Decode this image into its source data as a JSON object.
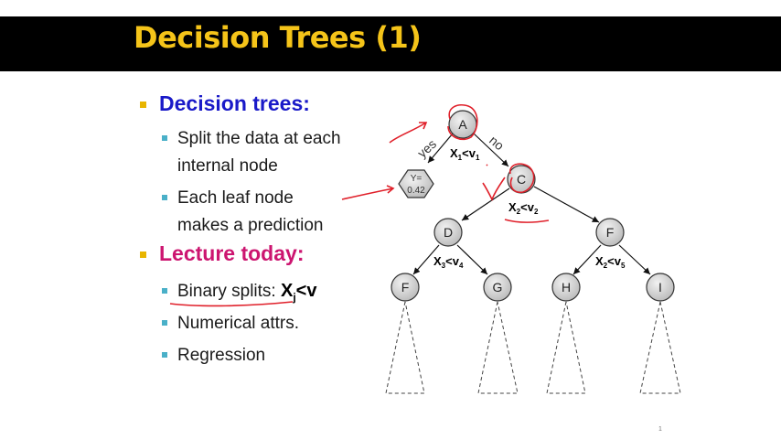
{
  "slide": {
    "title": "Decision Trees (1)",
    "page_number": "1"
  },
  "bullets": {
    "decision_trees": {
      "label": "Decision trees:",
      "items": [
        "Split the data at each",
        "internal node",
        "Each leaf node",
        "makes a prediction"
      ]
    },
    "lecture_today": {
      "label": "Lecture today:",
      "items": {
        "binary_prefix": "Binary splits: ",
        "binary_var": "X",
        "binary_sub": "j",
        "binary_rest": "<v",
        "numerical": "Numerical attrs.",
        "regression": "Regression"
      }
    }
  },
  "tree": {
    "nodes": {
      "A": "A",
      "C": "C",
      "D": "D",
      "F_right": "F",
      "F_left": "F",
      "G": "G",
      "H": "H",
      "I": "I"
    },
    "leaf": {
      "line1": "Y=",
      "line2": "0.42"
    },
    "edges": {
      "yes": "yes",
      "no": "no"
    },
    "splits": {
      "s1": {
        "var": "X",
        "sub": "1",
        "op": "<v",
        "vsub": "1"
      },
      "s2": {
        "var": "X",
        "sub": "2",
        "op": "<v",
        "vsub": "2"
      },
      "s3": {
        "var": "X",
        "sub": "3",
        "op": "<v",
        "vsub": "4"
      },
      "s4": {
        "var": "X",
        "sub": "2",
        "op": "<v",
        "vsub": "5"
      }
    }
  },
  "colors": {
    "title": "#f5c419",
    "bullet_square": "#e8b500",
    "sub_square": "#4ab0c8",
    "heading_blue": "#1a1ac8",
    "heading_magenta": "#cc1570",
    "annotation": "#e0202a"
  }
}
